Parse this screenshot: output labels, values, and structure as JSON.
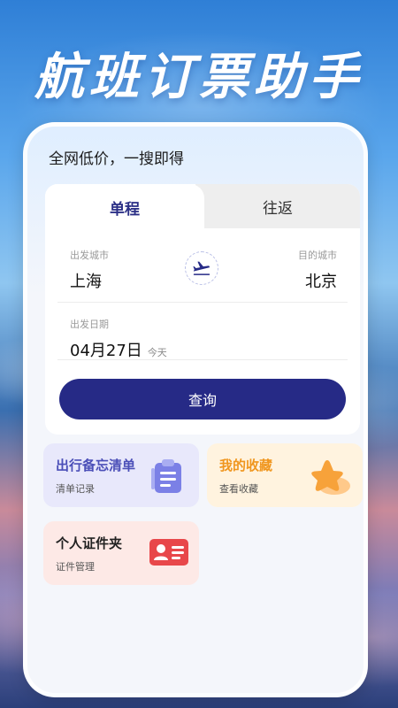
{
  "hero": {
    "title": "航班订票助手"
  },
  "app": {
    "slogan": "全网低价，一搜即得",
    "tabs": [
      {
        "label": "单程",
        "active": true
      },
      {
        "label": "往返",
        "active": false
      }
    ],
    "departure": {
      "label": "出发城市",
      "city": "上海"
    },
    "arrival": {
      "label": "目的城市",
      "city": "北京"
    },
    "date": {
      "label": "出发日期",
      "value": "04月27日",
      "note": "今天"
    },
    "search_button": "查询",
    "tiles": [
      {
        "title": "出行备忘清单",
        "subtitle": "清单记录",
        "icon": "clipboard-icon"
      },
      {
        "title": "我的收藏",
        "subtitle": "查看收藏",
        "icon": "star-icon"
      },
      {
        "title": "个人证件夹",
        "subtitle": "证件管理",
        "icon": "id-card-icon"
      }
    ]
  },
  "colors": {
    "primary": "#262a86",
    "memo_bg": "#e8e8fb",
    "favorite_bg": "#fff3df",
    "favorite_accent": "#f0961e",
    "id_bg": "#fde9e6",
    "id_accent": "#e8474a"
  }
}
